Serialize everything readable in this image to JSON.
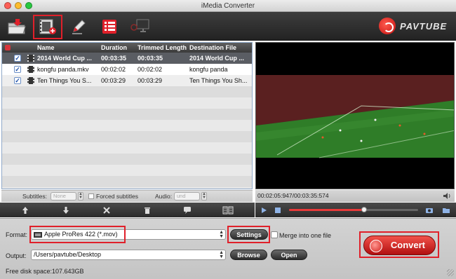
{
  "window": {
    "title": "iMedia Converter"
  },
  "brand": {
    "name": "PAVTUBE"
  },
  "toolbar": {
    "items": [
      "open-folder-icon",
      "add-video-icon",
      "edit-icon",
      "task-list-icon",
      "screen-icon"
    ]
  },
  "file_list": {
    "columns": [
      "Name",
      "Duration",
      "Trimmed Length",
      "Destination File"
    ],
    "rows": [
      {
        "checked": true,
        "name": "2014 World Cup ...",
        "duration": "00:03:35",
        "trimmed": "00:03:35",
        "destination": "2014 World Cup ..."
      },
      {
        "checked": true,
        "name": "kongfu panda.mkv",
        "duration": "00:02:02",
        "trimmed": "00:02:02",
        "destination": "kongfu panda"
      },
      {
        "checked": true,
        "name": "Ten Things You S...",
        "duration": "00:03:29",
        "trimmed": "00:03:29",
        "destination": "Ten Things You Sh..."
      }
    ]
  },
  "subtitles": {
    "label": "Subtitles:",
    "value": "None",
    "forced_label": "Forced subtitles"
  },
  "audio": {
    "label": "Audio:",
    "value": "und"
  },
  "preview": {
    "timecode": "00:02:05:947/00:03:35:574",
    "progress": 0.58
  },
  "format": {
    "label": "Format:",
    "value": "Apple ProRes 422 (*.mov)",
    "settings_label": "Settings",
    "merge_label": "Merge into one file"
  },
  "output": {
    "label": "Output:",
    "value": "/Users/pavtube/Desktop",
    "browse_label": "Browse",
    "open_label": "Open"
  },
  "disk": {
    "text": "Free disk space:107.643GB"
  },
  "convert": {
    "label": "Convert"
  },
  "colors": {
    "accent": "#e0202a",
    "selected_row": "#5a5d63",
    "convert": "#c8201c"
  }
}
